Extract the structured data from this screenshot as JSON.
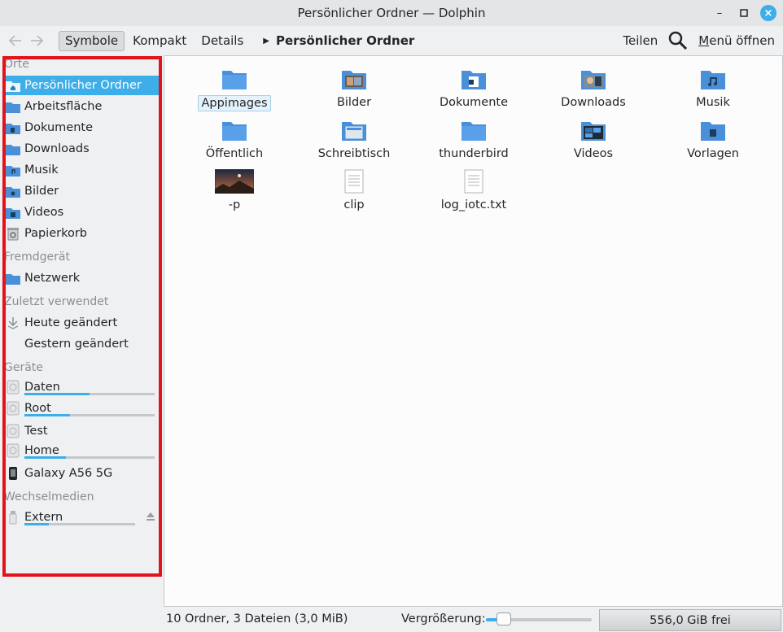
{
  "window": {
    "title": "Persönlicher Ordner — Dolphin"
  },
  "toolbar": {
    "view_modes": [
      "Symbole",
      "Kompakt",
      "Details"
    ],
    "active_view": "Symbole",
    "breadcrumb_current": "Persönlicher Ordner",
    "share_label": "Teilen",
    "menu_label_underlined": "M",
    "menu_label_rest": "enü öffnen"
  },
  "sidebar": {
    "sections": {
      "places": "Orte",
      "remote": "Fremdgerät",
      "recent": "Zuletzt verwendet",
      "devices": "Geräte",
      "removable": "Wechselmedien"
    },
    "places": [
      {
        "label": "Persönlicher Ordner",
        "icon": "home-folder-icon",
        "selected": true
      },
      {
        "label": "Arbeitsfläche",
        "icon": "desktop-folder-icon"
      },
      {
        "label": "Dokumente",
        "icon": "documents-folder-icon"
      },
      {
        "label": "Downloads",
        "icon": "downloads-folder-icon"
      },
      {
        "label": "Musik",
        "icon": "music-folder-icon"
      },
      {
        "label": "Bilder",
        "icon": "pictures-folder-icon"
      },
      {
        "label": "Videos",
        "icon": "videos-folder-icon"
      },
      {
        "label": "Papierkorb",
        "icon": "trash-icon"
      }
    ],
    "remote": [
      {
        "label": "Netzwerk",
        "icon": "network-folder-icon"
      }
    ],
    "recent": [
      {
        "label": "Heute geändert",
        "icon": "recent-icon"
      },
      {
        "label": "Gestern geändert",
        "icon": ""
      }
    ],
    "devices": [
      {
        "label": "Daten",
        "usage": 0.5
      },
      {
        "label": "Root",
        "usage": 0.35
      },
      {
        "label": "Test"
      },
      {
        "label": "Home",
        "usage": 0.32
      },
      {
        "label": "Galaxy A56 5G"
      }
    ],
    "removable": [
      {
        "label": "Extern",
        "usage": 0.22
      }
    ]
  },
  "files": [
    {
      "name": "Appimages",
      "kind": "folder",
      "selected": true
    },
    {
      "name": "Bilder",
      "kind": "folder-pictures"
    },
    {
      "name": "Dokumente",
      "kind": "folder-documents"
    },
    {
      "name": "Downloads",
      "kind": "folder-downloads"
    },
    {
      "name": "Musik",
      "kind": "folder-music"
    },
    {
      "name": "Öffentlich",
      "kind": "folder"
    },
    {
      "name": "Schreibtisch",
      "kind": "folder-desktop"
    },
    {
      "name": "thunderbird",
      "kind": "folder"
    },
    {
      "name": "Videos",
      "kind": "folder-videos"
    },
    {
      "name": "Vorlagen",
      "kind": "folder-templates"
    },
    {
      "name": "-p",
      "kind": "image"
    },
    {
      "name": "clip",
      "kind": "text"
    },
    {
      "name": "log_iotc.txt",
      "kind": "text"
    }
  ],
  "status": {
    "summary": "10 Ordner, 3 Dateien (3,0 MiB)",
    "zoom_label": "Vergrößerung:",
    "zoom_level": 0.15,
    "free_space": "556,0 GiB frei"
  },
  "colors": {
    "accent": "#3daee9",
    "folder": "#4a90d9",
    "highlight_border": "#e4121a"
  }
}
